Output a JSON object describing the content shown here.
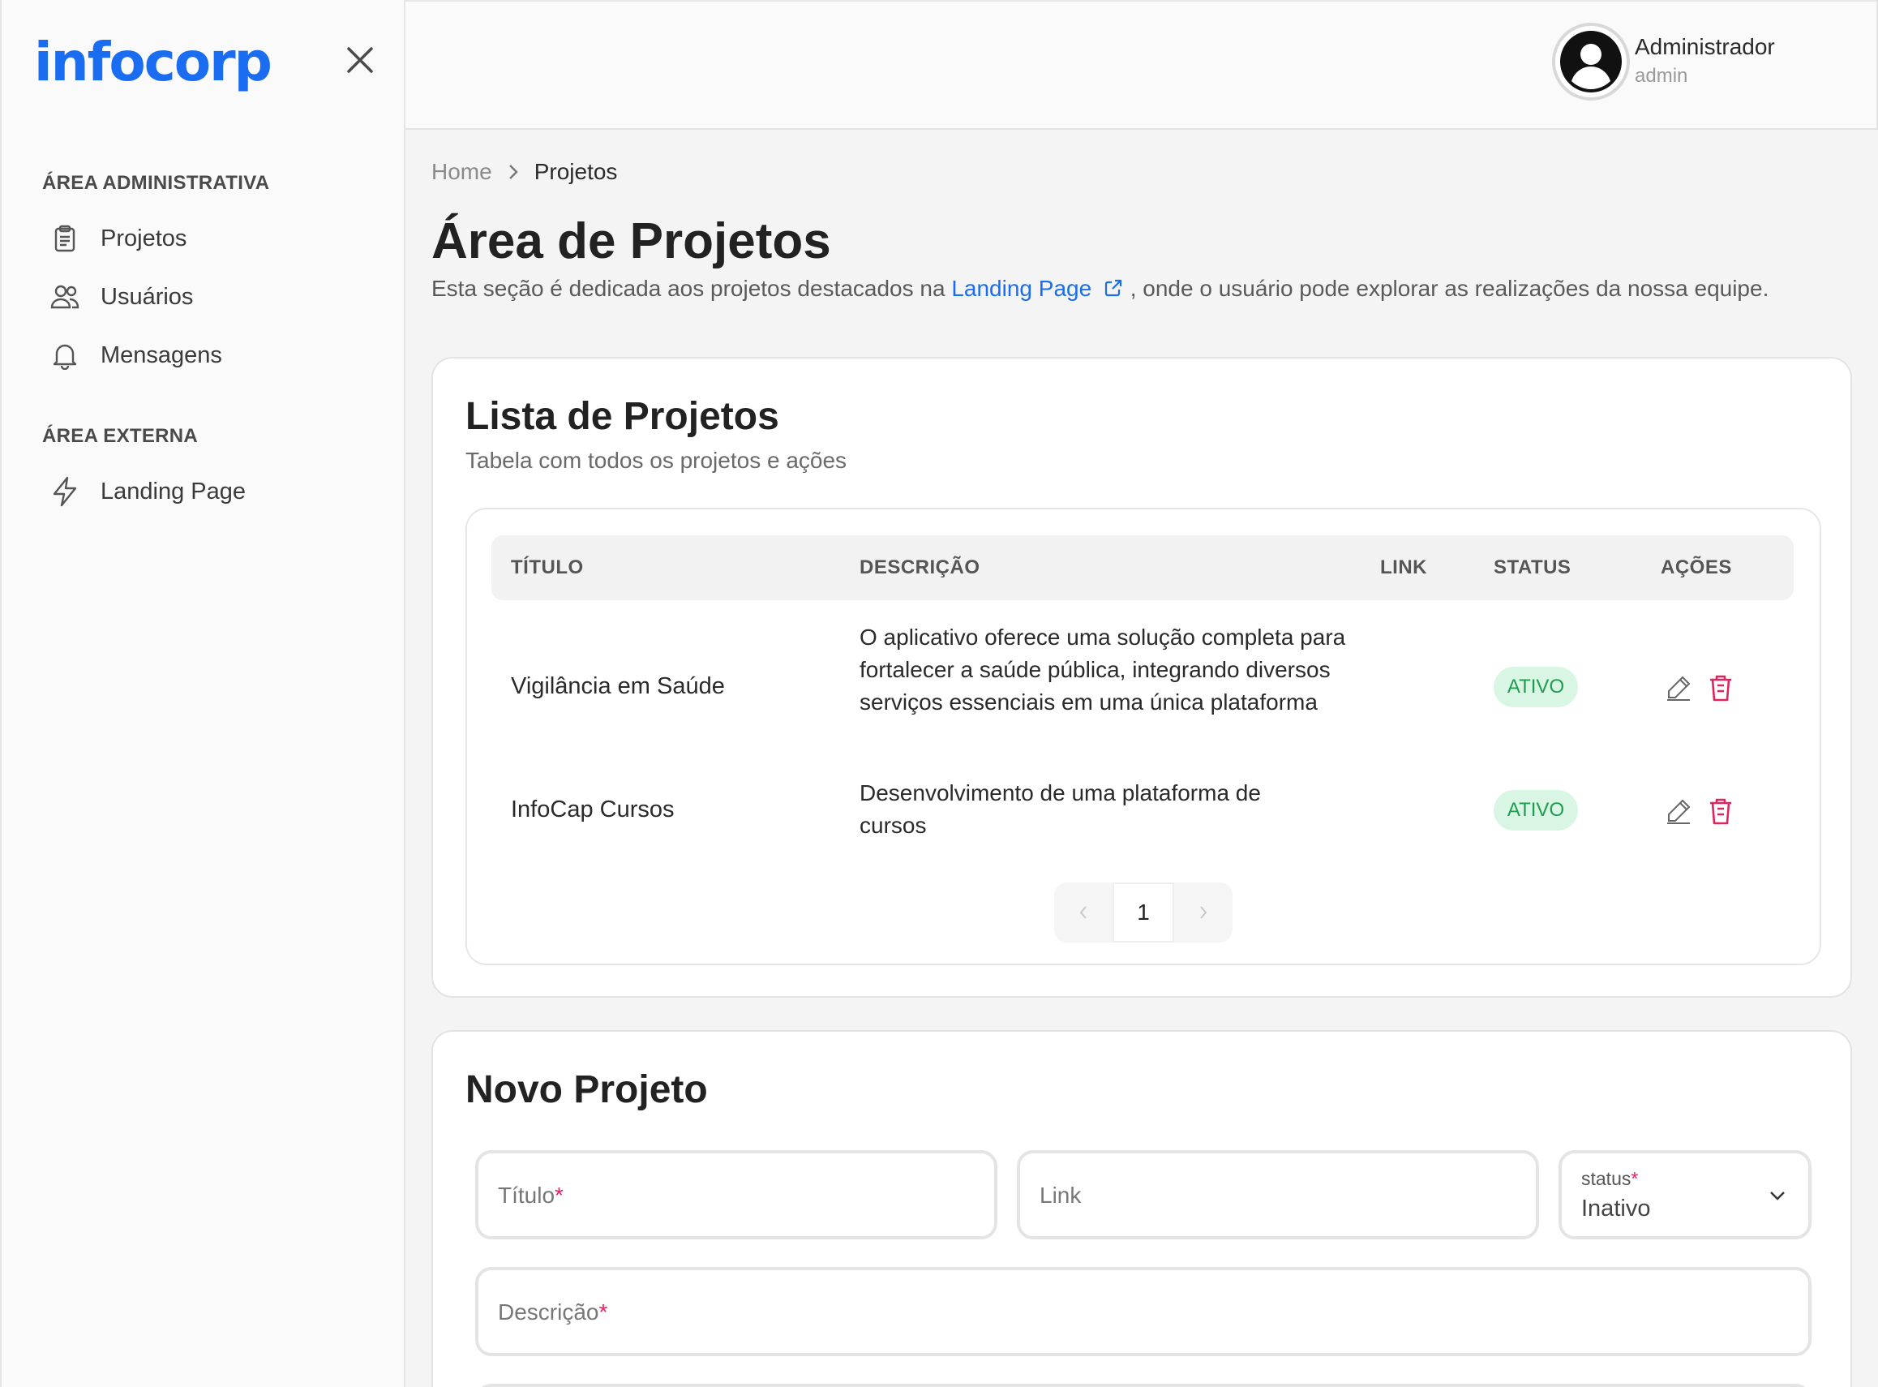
{
  "brand": {
    "logo_text": "infocorp",
    "accent": "#1a6df0"
  },
  "sidebar": {
    "sections": [
      {
        "title": "ÁREA ADMINISTRATIVA"
      },
      {
        "title": "ÁREA EXTERNA"
      }
    ],
    "items": [
      {
        "label": "Projetos",
        "icon": "clipboard-icon"
      },
      {
        "label": "Usuários",
        "icon": "users-icon"
      },
      {
        "label": "Mensagens",
        "icon": "bell-icon"
      },
      {
        "label": "Landing Page",
        "icon": "lightning-icon"
      }
    ]
  },
  "header": {
    "user_name": "Administrador",
    "user_login": "admin"
  },
  "breadcrumb": {
    "home": "Home",
    "current": "Projetos"
  },
  "page": {
    "title": "Área de Projetos",
    "desc_before": "Esta seção é dedicada aos projetos destacados na ",
    "desc_link": "Landing Page",
    "desc_after": " , onde o usuário pode explorar as realizações da nossa equipe."
  },
  "projects_card": {
    "title": "Lista de Projetos",
    "subtitle": "Tabela com todos os projetos e ações",
    "columns": [
      "TÍTULO",
      "DESCRIÇÃO",
      "LINK",
      "STATUS",
      "AÇÕES"
    ],
    "rows": [
      {
        "title": "Vigilância em Saúde",
        "desc": "O aplicativo oferece uma solução completa para fortalecer a saúde pública, integrando diversos serviços essenciais em uma única plataforma",
        "link": "",
        "status": "ATIVO"
      },
      {
        "title": "InfoCap Cursos",
        "desc": "Desenvolvimento de uma plataforma de cursos",
        "link": "",
        "status": "ATIVO"
      }
    ],
    "pagination": {
      "current_page": "1"
    },
    "status_colors": {
      "active_bg": "#d9f5e3",
      "active_fg": "#1f9d4e",
      "delete": "#e0245e"
    }
  },
  "new_project": {
    "title": "Novo Projeto",
    "title_field": {
      "placeholder": "Título",
      "required": "*"
    },
    "link_field": {
      "placeholder": "Link"
    },
    "status_field": {
      "label": "status",
      "required": "*",
      "value": "Inativo"
    },
    "desc_field": {
      "placeholder": "Descrição",
      "required": "*"
    }
  }
}
